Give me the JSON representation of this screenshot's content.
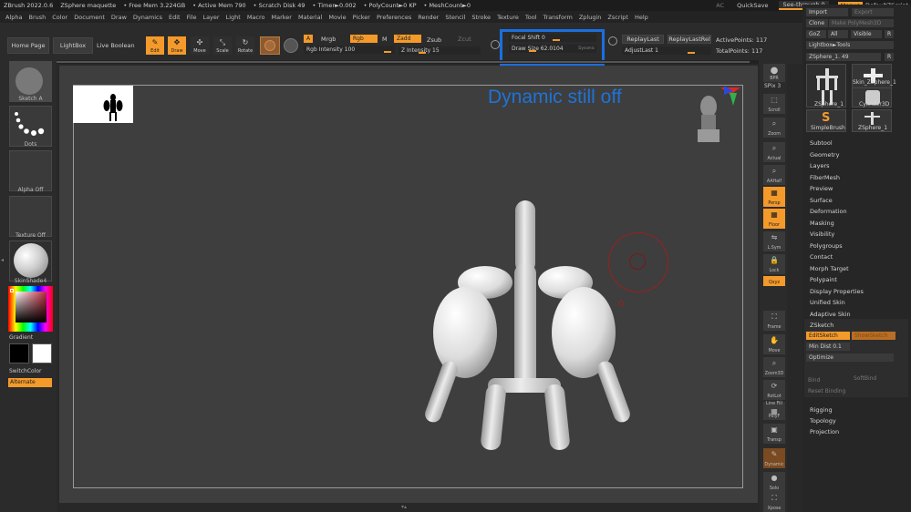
{
  "titlebar": {
    "segments": [
      "ZBrush 2022.0.6",
      "ZSphere maquette",
      "• Free Mem 3.224GB",
      "• Active Mem 790",
      "• Scratch Disk 49",
      "• Timer►0.002",
      "• PolyCount►0 KP",
      "• MeshCount►0"
    ],
    "ac": "AC",
    "quicksave": "QuickSave",
    "see_through": "See-through  0",
    "menus": "Menus",
    "script": "DefaultZScript"
  },
  "menubar": [
    "Alpha",
    "Brush",
    "Color",
    "Document",
    "Draw",
    "Dynamics",
    "Edit",
    "File",
    "Layer",
    "Light",
    "Macro",
    "Marker",
    "Material",
    "Movie",
    "Picker",
    "Preferences",
    "Render",
    "Stencil",
    "Stroke",
    "Texture",
    "Tool",
    "Transform",
    "Zplugin",
    "Zscript",
    "Help"
  ],
  "toolbar": {
    "home_page": "Home Page",
    "lightbox": "LightBox",
    "live_boolean": "Live Boolean",
    "edit": "Edit",
    "draw": "Draw",
    "move": "Move",
    "scale": "Scale",
    "rotate": "Rotate",
    "a": "A",
    "mrgb": "Mrgb",
    "rgb": "Rgb",
    "m": "M",
    "zadd": "Zadd",
    "zsub": "Zsub",
    "zcut": "Zcut",
    "rgb_intensity": "Rgb Intensity 100",
    "z_intensity": "Z Intensity 15",
    "focal_shift": "Focal Shift 0",
    "draw_size": "Draw Size 62.0104",
    "dynamic": "Dynamic",
    "replay_last": "ReplayLast",
    "replay_last_rel": "ReplayLastRel",
    "adjust_last": "AdjustLast 1",
    "active_points": "ActivePoints: 117",
    "total_points": "TotalPoints: 117"
  },
  "leftpanel": {
    "sketch": "Sketch A",
    "dots": "Dots",
    "alpha": "Alpha Off",
    "texture": "Texture Off",
    "material": "SkinShade4",
    "gradient": "Gradient",
    "switch_color": "SwitchColor",
    "alternate": "Alternate"
  },
  "viewport": {
    "overlay_text": "Dynamic still off"
  },
  "rightshelf": {
    "bpr": "BPR",
    "spix": "SPix 3",
    "scroll": "Scroll",
    "zoom": "Zoom",
    "actual": "Actual",
    "aahalf": "AAHalf",
    "persp": "Persp",
    "floor": "Floor",
    "lsym": "L.Sym",
    "lock": "Lock",
    "qxyz": "Qxyz",
    "frame": "Frame",
    "move": "Move",
    "zoom3d": "Zoom3D",
    "rotate": "RotLot",
    "linefill": "Line Fill",
    "polyf": "PolyF",
    "transp": "Transp",
    "dynamic": "Dynamic",
    "solo": "Solo",
    "xpose": "Xpose"
  },
  "rightpanel": {
    "import": "Import",
    "export": "Export",
    "clone": "Clone",
    "make_polymesh": "Make PolyMesh3D",
    "goz": "GoZ",
    "all": "All",
    "visible": "Visible",
    "r": "R",
    "lightbox_tools": "Lightbox►Tools",
    "zsphere_slider": "ZSphere_1. 49",
    "thumbs": [
      "ZSphere_1",
      "Skin_ZSphere_1",
      "Cylinder3D",
      "SimpleBrush",
      "ZSphere_1"
    ],
    "items": [
      "Subtool",
      "Geometry",
      "Layers",
      "FiberMesh",
      "Preview",
      "Surface",
      "Deformation",
      "Masking",
      "Visibility",
      "Polygroups",
      "Contact",
      "Morph Target",
      "Polypaint",
      "Display Properties",
      "Unified Skin",
      "Adaptive Skin"
    ],
    "zsketch": "ZSketch",
    "edit_sketch": "EditSketch",
    "show_sketch": "ShowSketch",
    "min_dist": "Min Dist 0.1",
    "optimize": "Optimize",
    "bind": "Bind",
    "soft_bind": "SoftBind",
    "reset_binding": "Reset Binding",
    "lower_items": [
      "Rigging",
      "Topology",
      "Projection"
    ]
  },
  "colors": {
    "accent": "#f39a2b",
    "highlight_box": "#1a6fe0",
    "overlay_text": "#1f73d6"
  }
}
